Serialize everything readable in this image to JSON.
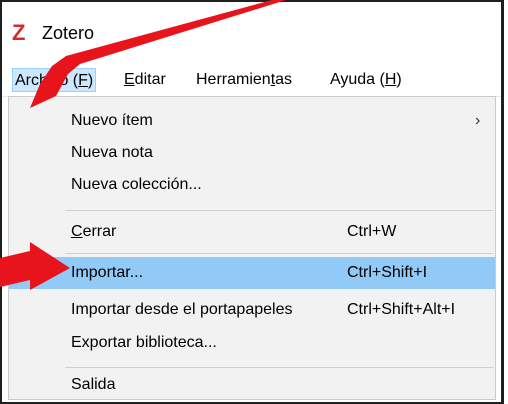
{
  "window": {
    "title": "Zotero",
    "logo_letter": "Z"
  },
  "menubar": {
    "items": [
      {
        "label_pre": "Archivo (",
        "mnemonic": "F",
        "label_post": ")"
      },
      {
        "label_pre": "",
        "mnemonic": "E",
        "label_post": "ditar"
      },
      {
        "label_pre": "Herramien",
        "mnemonic": "t",
        "label_post": "as"
      },
      {
        "label_pre": "Ayuda (",
        "mnemonic": "H",
        "label_post": ")"
      }
    ]
  },
  "menu": {
    "items": [
      {
        "label": "Nuevo ítem",
        "shortcut": "",
        "submenu": true
      },
      {
        "label": "Nueva nota",
        "shortcut": ""
      },
      {
        "label": "Nueva colección...",
        "shortcut": ""
      },
      {
        "label_pre": "",
        "mnemonic": "C",
        "label_post": "errar",
        "shortcut": "Ctrl+W"
      },
      {
        "label": "Importar...",
        "shortcut": "Ctrl+Shift+I",
        "highlighted": true
      },
      {
        "label": "Importar desde el portapapeles",
        "shortcut": "Ctrl+Shift+Alt+I"
      },
      {
        "label": "Exportar biblioteca...",
        "shortcut": ""
      },
      {
        "label": "Salida",
        "shortcut": ""
      }
    ],
    "submenu_glyph": "›"
  },
  "colors": {
    "highlight": "#91c9f7",
    "logo": "#d22b2b",
    "annotation_arrow": "#e8141c"
  }
}
